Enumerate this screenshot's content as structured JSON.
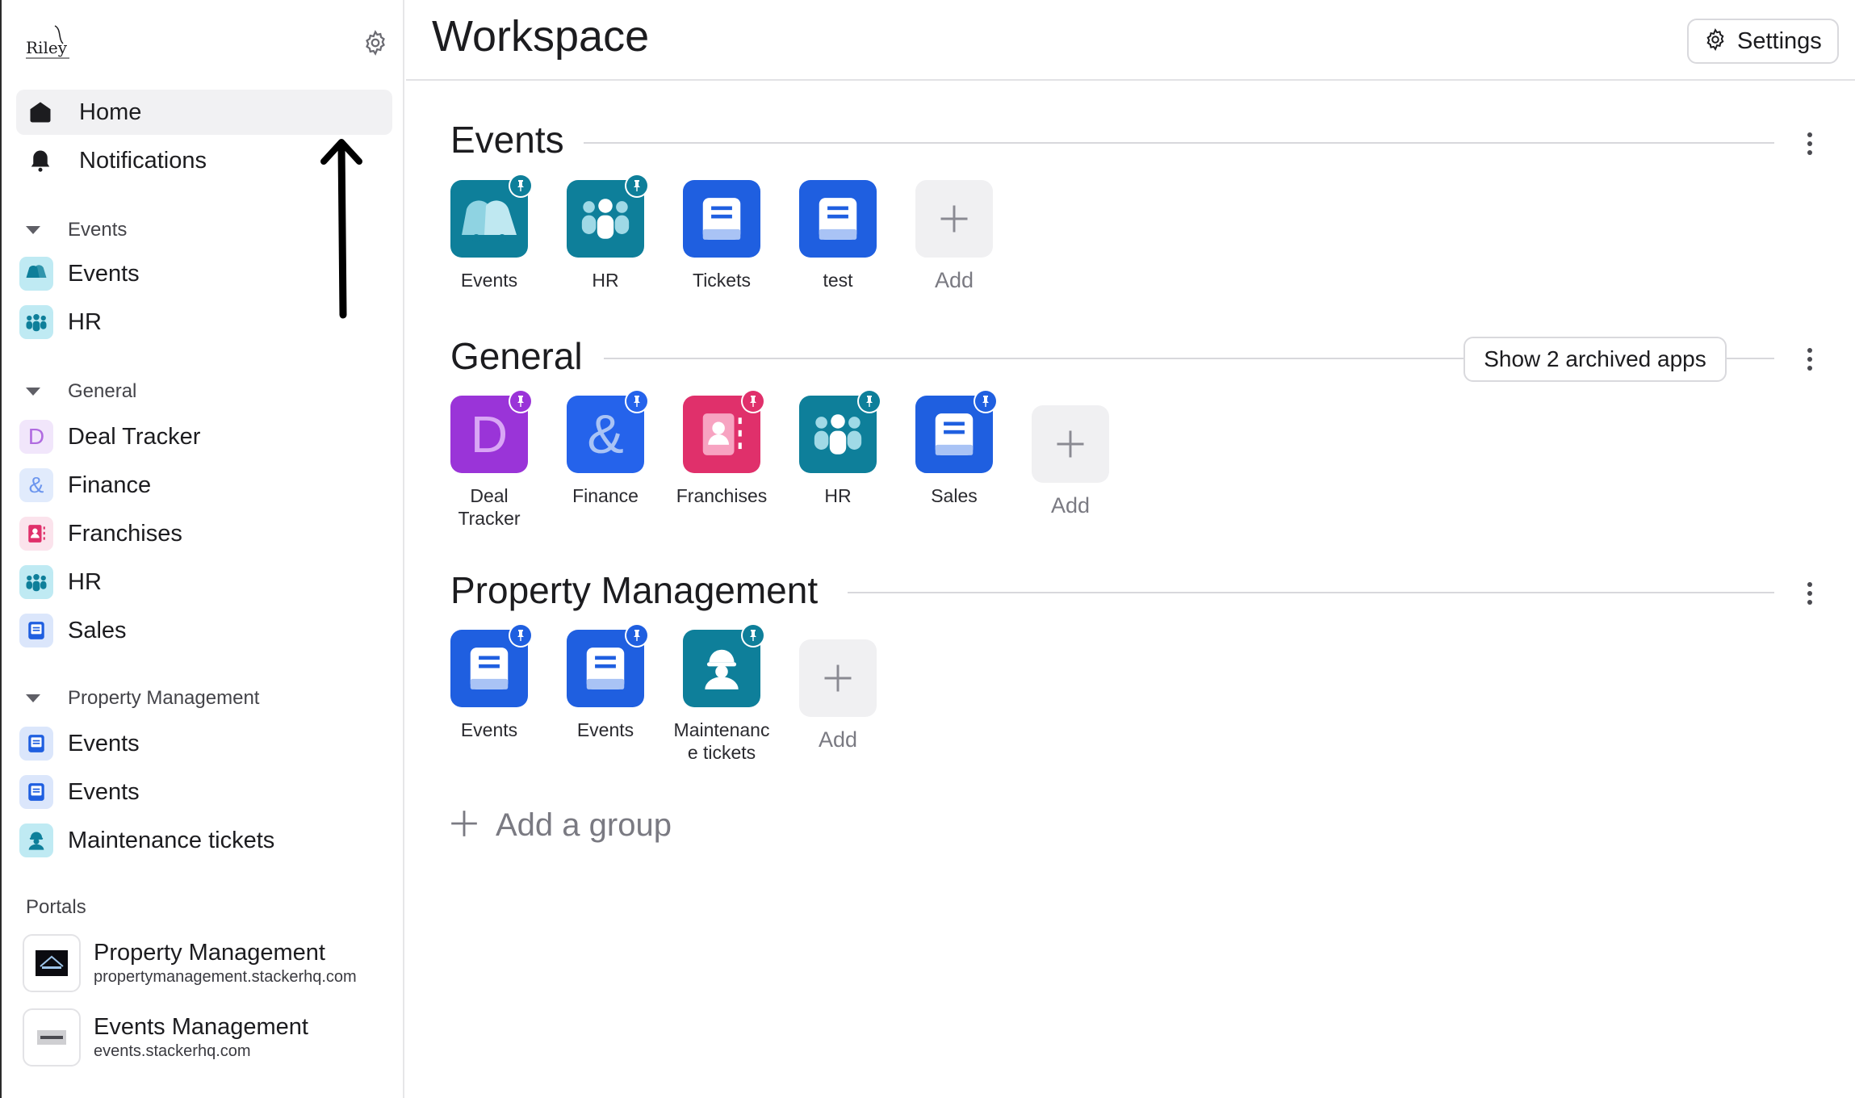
{
  "window": {
    "title": "Workspace"
  },
  "sidebar": {
    "nav": [
      {
        "label": "Home",
        "icon": "home-icon"
      },
      {
        "label": "Notifications",
        "icon": "bell-icon"
      }
    ],
    "groups": [
      {
        "label": "Events",
        "items": [
          {
            "label": "Events",
            "icon": "bells-icon",
            "color": "#bfeaf3"
          },
          {
            "label": "HR",
            "icon": "people-icon",
            "color": "#bfeaf3"
          }
        ]
      },
      {
        "label": "General",
        "items": [
          {
            "label": "Deal Tracker",
            "icon": "letter-d-icon",
            "glyph": "D",
            "color": "#f1e6fb"
          },
          {
            "label": "Finance",
            "icon": "ampersand-icon",
            "glyph": "&",
            "color": "#e1ebfc"
          },
          {
            "label": "Franchises",
            "icon": "contact-book-icon",
            "color": "#fbe3ec"
          },
          {
            "label": "HR",
            "icon": "people-icon",
            "color": "#bfeaf3"
          },
          {
            "label": "Sales",
            "icon": "book-icon",
            "color": "#dbe6fb"
          }
        ]
      },
      {
        "label": "Property Management",
        "items": [
          {
            "label": "Events",
            "icon": "book-icon",
            "color": "#dbe6fb"
          },
          {
            "label": "Events",
            "icon": "book-icon",
            "color": "#dbe6fb"
          },
          {
            "label": "Maintenance tickets",
            "icon": "worker-icon",
            "color": "#bfeaf3"
          }
        ]
      }
    ],
    "portals_label": "Portals",
    "portals": [
      {
        "name": "Property Management",
        "url": "propertymanagement.stackerhq.com"
      },
      {
        "name": "Events Management",
        "url": "events.stackerhq.com"
      }
    ]
  },
  "header": {
    "title": "Workspace",
    "settings_label": "Settings"
  },
  "sections": [
    {
      "title": "Events",
      "apps": [
        {
          "label": "Events",
          "icon": "bells-icon",
          "color": "#0e7f9a"
        },
        {
          "label": "HR",
          "icon": "people-icon",
          "color": "#0e7f9a"
        },
        {
          "label": "Tickets",
          "icon": "book-icon",
          "color": "#1f5fe0"
        },
        {
          "label": "test",
          "icon": "book-icon",
          "color": "#1f5fe0"
        }
      ],
      "add_label": "Add"
    },
    {
      "title": "General",
      "archived_label": "Show 2 archived apps",
      "apps": [
        {
          "label": "Deal Tracker",
          "icon": "letter-d-icon",
          "color": "#9a34d8"
        },
        {
          "label": "Finance",
          "icon": "ampersand-icon",
          "color": "#2563eb"
        },
        {
          "label": "Franchises",
          "icon": "contact-book-icon",
          "color": "#e0306b"
        },
        {
          "label": "HR",
          "icon": "people-icon",
          "color": "#0e7f9a"
        },
        {
          "label": "Sales",
          "icon": "book-icon",
          "color": "#1f5fe0"
        }
      ],
      "add_label": "Add"
    },
    {
      "title": "Property Management",
      "apps": [
        {
          "label": "Events",
          "icon": "book-icon",
          "color": "#1f5fe0"
        },
        {
          "label": "Events",
          "icon": "book-icon",
          "color": "#1f5fe0"
        },
        {
          "label": "Maintenanc e tickets",
          "icon": "worker-icon",
          "color": "#0e7f9a"
        }
      ],
      "add_label": "Add"
    }
  ],
  "add_group_label": "Add a group"
}
